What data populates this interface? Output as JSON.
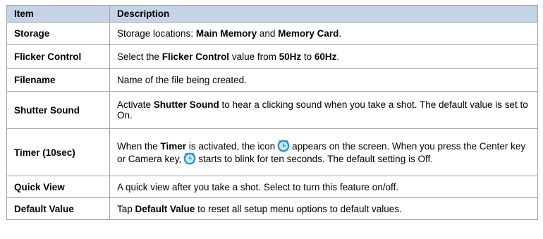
{
  "table": {
    "header": {
      "item": "Item",
      "description": "Description"
    },
    "rows": {
      "storage": {
        "item": "Storage",
        "d": [
          "Storage locations: ",
          "Main Memory",
          " and ",
          "Memory Card",
          "."
        ]
      },
      "flicker": {
        "item": "Flicker Control",
        "d": [
          "Select the ",
          "Flicker Control",
          " value from ",
          "50Hz",
          " to ",
          "60Hz",
          "."
        ]
      },
      "filename": {
        "item": "Filename",
        "d": [
          "Name of the file being created."
        ]
      },
      "shutter": {
        "item": "Shutter Sound",
        "d": [
          "Activate ",
          "Shutter Sound",
          " to hear a clicking sound when you take a shot. The default value is set to On."
        ]
      },
      "timer": {
        "item": "Timer (10sec)",
        "d": [
          "When the ",
          "Timer",
          " is activated, the icon",
          "appears on the screen. When you press the Center key or Camera key,",
          "starts to blink for ten seconds. The default setting is Off."
        ]
      },
      "quick": {
        "item": "Quick View",
        "d": [
          "A quick view after you take a shot. Select to turn this feature on/off."
        ]
      },
      "default": {
        "item": "Default Value",
        "d": [
          "Tap ",
          "Default Value",
          " to reset all setup menu options to default values."
        ]
      }
    }
  },
  "colors": {
    "header_bg": "#c5d3e6",
    "border": "#a4a4a4",
    "timer_icon_outer": "#2f8fd8",
    "timer_icon_inner": "#c6ecf7"
  },
  "icons": {
    "timer": "timer-icon"
  }
}
